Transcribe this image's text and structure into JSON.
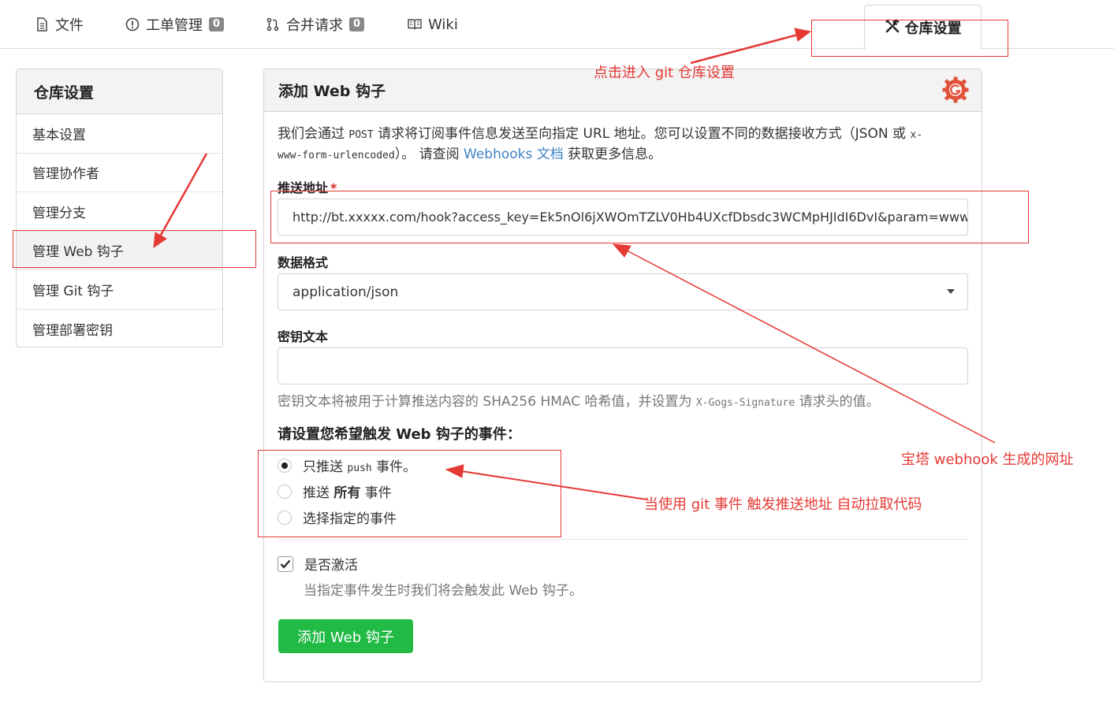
{
  "tabs": [
    {
      "label": "文件",
      "icon": "file-icon"
    },
    {
      "label": "工单管理",
      "icon": "issue-icon",
      "badge": "0"
    },
    {
      "label": "合并请求",
      "icon": "pull-request-icon",
      "badge": "0"
    },
    {
      "label": "Wiki",
      "icon": "book-icon"
    },
    {
      "label": "仓库设置",
      "icon": "tools-icon",
      "active": true
    }
  ],
  "sidebar": {
    "title": "仓库设置",
    "items": [
      {
        "label": "基本设置"
      },
      {
        "label": "管理协作者"
      },
      {
        "label": "管理分支"
      },
      {
        "label": "管理 Web 钩子",
        "active": true
      },
      {
        "label": "管理 Git 钩子"
      },
      {
        "label": "管理部署密钥"
      }
    ]
  },
  "panel": {
    "title": "添加 Web 钩子",
    "desc": {
      "p1": "我们会通过 ",
      "post": "POST",
      "p2": " 请求将订阅事件信息发送至向指定 URL 地址。您可以设置不同的数据接收方式（JSON 或 ",
      "form1": "x-",
      "form2": "www-form-urlencoded",
      "p3": "）。 请查阅 ",
      "link": "Webhooks 文档",
      "p4": " 获取更多信息。"
    },
    "payload_url": {
      "label": "推送地址",
      "required_mark": "*",
      "value": "http://bt.xxxxx.com/hook?access_key=Ek5nOl6jXWOmTZLV0Hb4UXcfDbsdc3WCMpHJIdI6DvI&param=www"
    },
    "content_type": {
      "label": "数据格式",
      "value": "application/json"
    },
    "secret": {
      "label": "密钥文本",
      "value": "",
      "help1": "密钥文本将被用于计算推送内容的 SHA256 HMAC 哈希值，并设置为 ",
      "help_code": "X-Gogs-Signature",
      "help2": " 请求头的值。"
    },
    "events": {
      "title": "请设置您希望触发 Web 钩子的事件：",
      "opt1_a": "只推送 ",
      "opt1_code": "push",
      "opt1_b": " 事件。",
      "opt2_a": "推送 ",
      "opt2_bold": "所有",
      "opt2_b": " 事件",
      "opt3": "选择指定的事件",
      "selected": 1
    },
    "active": {
      "label": "是否激活",
      "help": "当指定事件发生时我们将会触发此 Web 钩子。",
      "checked": true
    },
    "submit_label": "添加 Web 钩子"
  },
  "annotations": {
    "settings_note": "点击进入 git 仓库设置",
    "url_note": "宝塔 webhook 生成的网址",
    "event_note": "当使用 git 事件 触发推送地址 自动拉取代码",
    "color": "#e53935"
  }
}
